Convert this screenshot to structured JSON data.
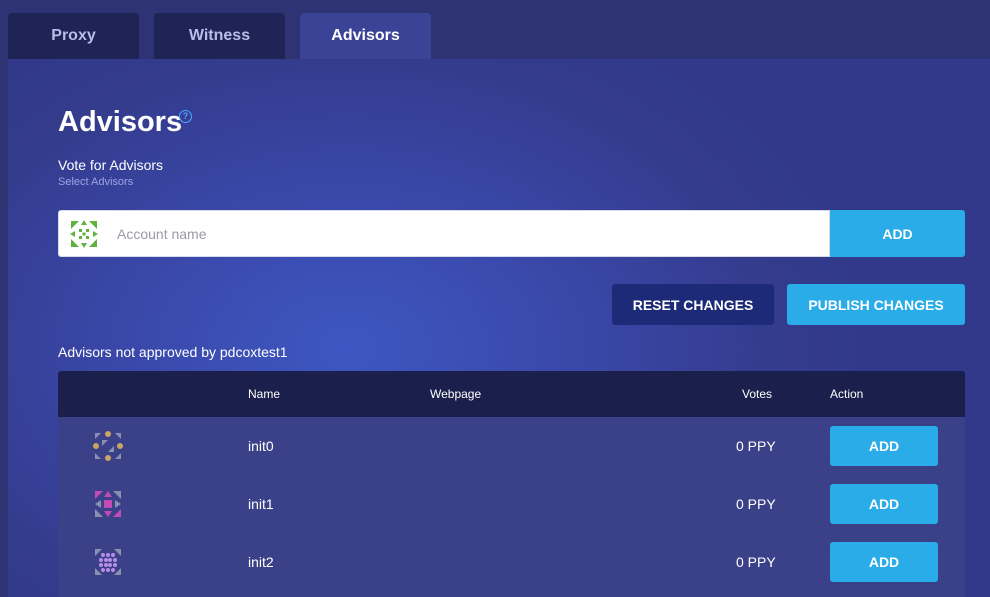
{
  "tabs": [
    {
      "label": "Proxy"
    },
    {
      "label": "Witness"
    },
    {
      "label": "Advisors"
    }
  ],
  "page": {
    "title": "Advisors",
    "help_icon": "?",
    "subtitle": "Vote for Advisors",
    "hint": "Select Advisors"
  },
  "search": {
    "value": "",
    "placeholder": "Account name",
    "add_label": "ADD"
  },
  "actions": {
    "reset_label": "RESET CHANGES",
    "publish_label": "PUBLISH CHANGES"
  },
  "table": {
    "label": "Advisors not approved by pdcoxtest1",
    "headers": {
      "name": "Name",
      "webpage": "Webpage",
      "votes": "Votes",
      "action": "Action"
    },
    "rows": [
      {
        "name": "init0",
        "webpage": "",
        "votes": "0 PPY",
        "action": "ADD",
        "avatar": "identicon-gold"
      },
      {
        "name": "init1",
        "webpage": "",
        "votes": "0 PPY",
        "action": "ADD",
        "avatar": "identicon-magenta"
      },
      {
        "name": "init2",
        "webpage": "",
        "votes": "0 PPY",
        "action": "ADD",
        "avatar": "identicon-violet"
      }
    ]
  },
  "colors": {
    "accent_blue": "#2aace8",
    "navy_button": "#1d2a78",
    "header_bg": "#1b1f4b",
    "identicon_green": "#5db33d",
    "identicon_gold": "#c9a462",
    "identicon_magenta": "#c24bb4",
    "identicon_violet": "#b88be6"
  }
}
